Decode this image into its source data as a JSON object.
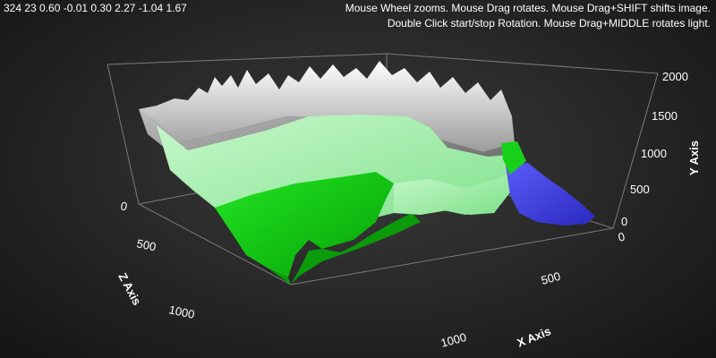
{
  "status_text": "324 23 0.60 -0.01 0.30 2.27 -1.04 1.67",
  "help_lines": [
    "Mouse Wheel zooms. Mouse Drag rotates. Mouse Drag+SHIFT shifts image.",
    "Double Click start/stop Rotation. Mouse Drag+MIDDLE rotates light."
  ],
  "axes": {
    "y": {
      "title": "Y Axis",
      "ticks": [
        "2000",
        "1500",
        "1000",
        "500",
        "0"
      ]
    },
    "x": {
      "title": "X Axis",
      "ticks": [
        "0",
        "500",
        "1000"
      ]
    },
    "z": {
      "title": "Z Axis",
      "ticks": [
        "0",
        "500",
        "1000"
      ]
    }
  },
  "colors": {
    "snow": "#e8e8e8",
    "rock": "#8a8a8a",
    "light_green": "#a8f0b0",
    "green": "#10d010",
    "dark_green": "#0a9a0a",
    "water": "#4a4ae8",
    "axis": "#7a7a7a"
  }
}
